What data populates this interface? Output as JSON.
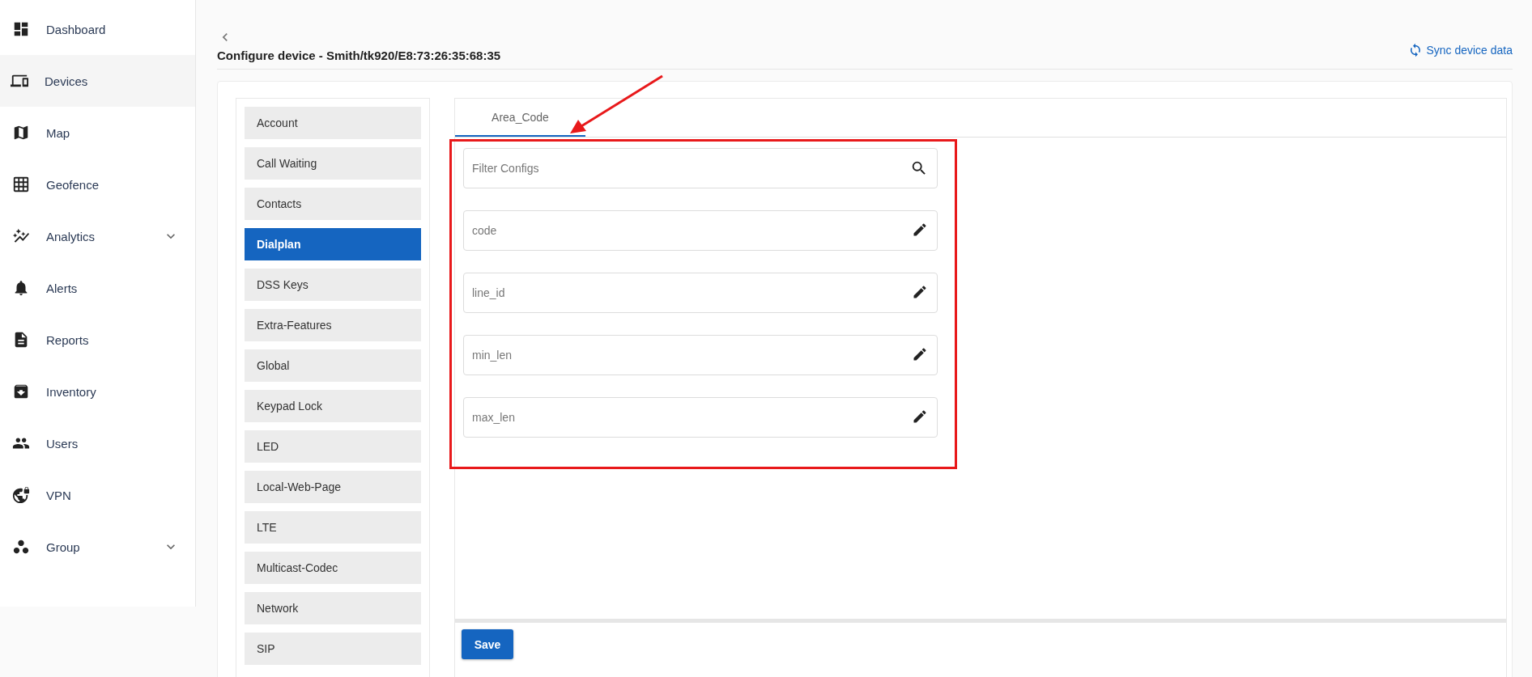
{
  "sidebar": {
    "items": [
      {
        "label": "Dashboard",
        "selected": false,
        "expandable": false
      },
      {
        "label": "Devices",
        "selected": true,
        "expandable": false
      },
      {
        "label": "Map",
        "selected": false,
        "expandable": false
      },
      {
        "label": "Geofence",
        "selected": false,
        "expandable": false
      },
      {
        "label": "Analytics",
        "selected": false,
        "expandable": true
      },
      {
        "label": "Alerts",
        "selected": false,
        "expandable": false
      },
      {
        "label": "Reports",
        "selected": false,
        "expandable": false
      },
      {
        "label": "Inventory",
        "selected": false,
        "expandable": false
      },
      {
        "label": "Users",
        "selected": false,
        "expandable": false
      },
      {
        "label": "VPN",
        "selected": false,
        "expandable": false
      },
      {
        "label": "Group",
        "selected": false,
        "expandable": true
      }
    ]
  },
  "header": {
    "title": "Configure device - Smith/tk920/E8:73:26:35:68:35",
    "sync_link": "Sync device data"
  },
  "categories": [
    {
      "label": "Account",
      "selected": false
    },
    {
      "label": "Call Waiting",
      "selected": false
    },
    {
      "label": "Contacts",
      "selected": false
    },
    {
      "label": "Dialplan",
      "selected": true
    },
    {
      "label": "DSS Keys",
      "selected": false
    },
    {
      "label": "Extra-Features",
      "selected": false
    },
    {
      "label": "Global",
      "selected": false
    },
    {
      "label": "Keypad Lock",
      "selected": false
    },
    {
      "label": "LED",
      "selected": false
    },
    {
      "label": "Local-Web-Page",
      "selected": false
    },
    {
      "label": "LTE",
      "selected": false
    },
    {
      "label": "Multicast-Codec",
      "selected": false
    },
    {
      "label": "Network",
      "selected": false
    },
    {
      "label": "SIP",
      "selected": false
    }
  ],
  "tabs": [
    {
      "label": "Area_Code",
      "selected": true
    }
  ],
  "filter": {
    "placeholder": "Filter Configs"
  },
  "configs": [
    {
      "placeholder": "code"
    },
    {
      "placeholder": "line_id"
    },
    {
      "placeholder": "min_len"
    },
    {
      "placeholder": "max_len"
    }
  ],
  "save_button": "Save"
}
